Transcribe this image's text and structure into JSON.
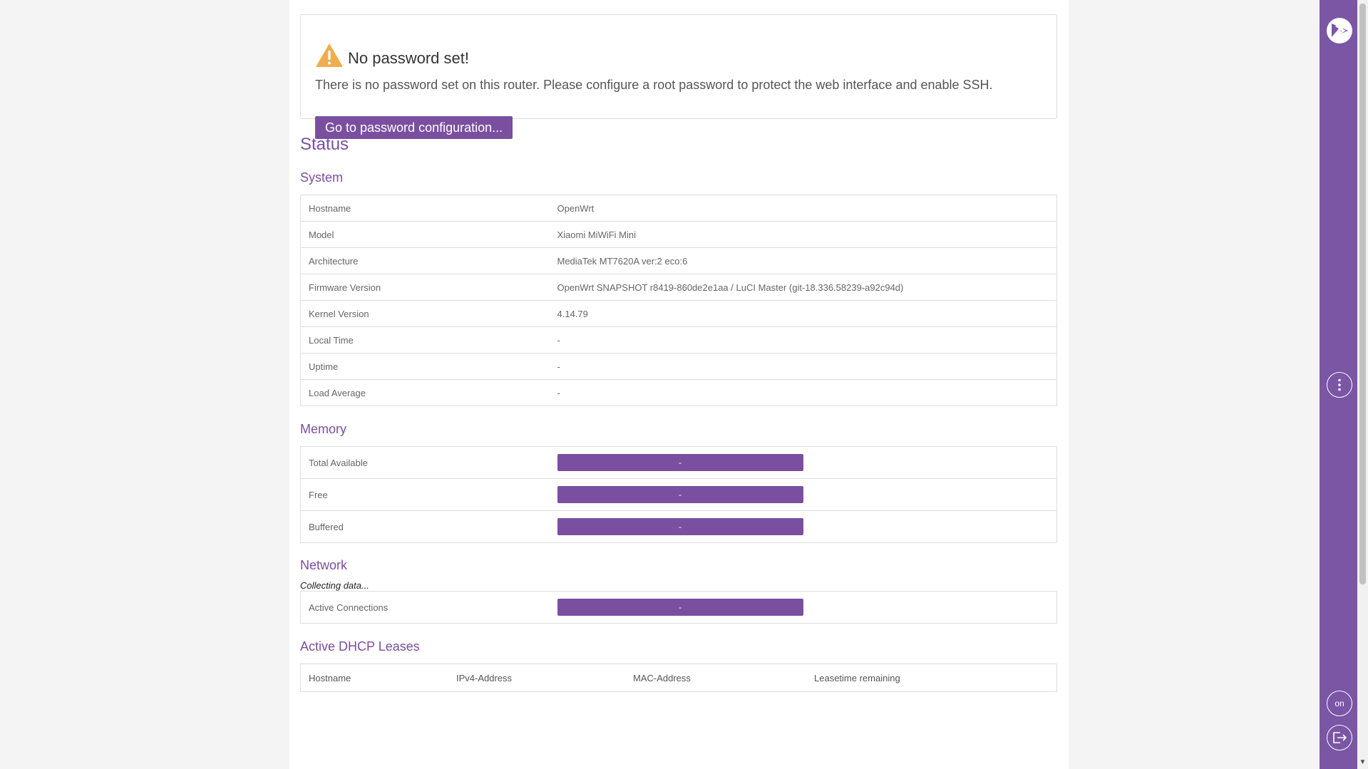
{
  "alert": {
    "title": "No password set!",
    "text": "There is no password set on this router. Please configure a root password to protect the web interface and enable SSH.",
    "button": "Go to password configuration..."
  },
  "page_title": "Status",
  "system": {
    "heading": "System",
    "rows": [
      {
        "label": "Hostname",
        "value": "OpenWrt"
      },
      {
        "label": "Model",
        "value": "Xiaomi MiWiFi Mini"
      },
      {
        "label": "Architecture",
        "value": "MediaTek MT7620A ver:2 eco:6"
      },
      {
        "label": "Firmware Version",
        "value": "OpenWrt SNAPSHOT r8419-860de2e1aa / LuCI Master (git-18.336.58239-a92c94d)"
      },
      {
        "label": "Kernel Version",
        "value": "4.14.79"
      },
      {
        "label": "Local Time",
        "value": "-"
      },
      {
        "label": "Uptime",
        "value": "-"
      },
      {
        "label": "Load Average",
        "value": "-"
      }
    ]
  },
  "memory": {
    "heading": "Memory",
    "rows": [
      {
        "label": "Total Available",
        "value": "-"
      },
      {
        "label": "Free",
        "value": "-"
      },
      {
        "label": "Buffered",
        "value": "-"
      }
    ]
  },
  "network": {
    "heading": "Network",
    "collecting": "Collecting data...",
    "rows": [
      {
        "label": "Active Connections",
        "value": "-"
      }
    ]
  },
  "dhcp": {
    "heading": "Active DHCP Leases",
    "columns": [
      "Hostname",
      "IPv4-Address",
      "MAC-Address",
      "Leasetime remaining"
    ]
  },
  "sidebar": {
    "logo_icon": "openwrt-logo-icon",
    "menu_icon": "vertical-dots-icon",
    "toggle_label": "on",
    "logout_icon": "logout-icon"
  },
  "colors": {
    "accent": "#7a4fa0",
    "sidebar": "#7a56a5",
    "warning": "#f0ad4e"
  }
}
